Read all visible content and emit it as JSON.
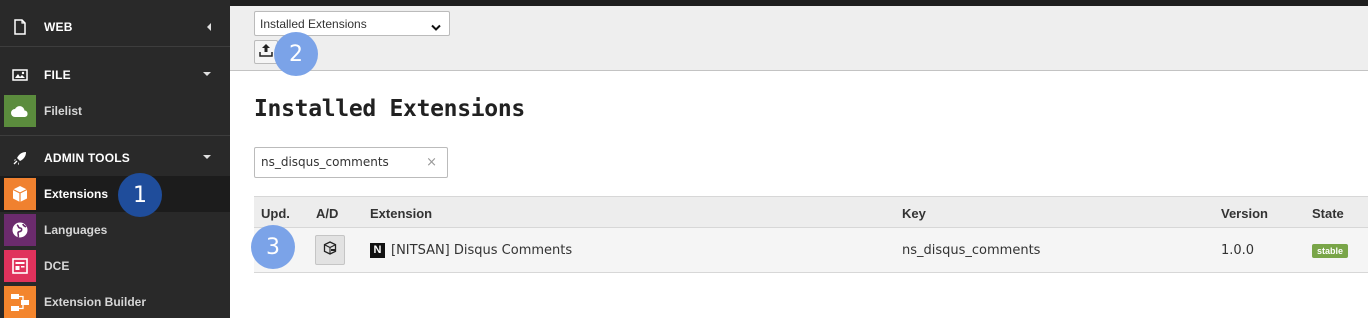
{
  "sidebar": {
    "groups": [
      {
        "label": "WEB",
        "icon": "document-icon"
      },
      {
        "label": "FILE",
        "icon": "image-icon"
      },
      {
        "label": "ADMIN TOOLS",
        "icon": "rocket-icon"
      }
    ],
    "items": [
      {
        "label": "Filelist",
        "icon": "cloud-icon",
        "color": "#5b8c3d"
      },
      {
        "label": "Extensions",
        "icon": "box-icon",
        "color": "#f0812f"
      },
      {
        "label": "Languages",
        "icon": "globe-icon",
        "color": "#6b2b6d"
      },
      {
        "label": "DCE",
        "icon": "dce-icon",
        "color": "#e0325c"
      },
      {
        "label": "Extension Builder",
        "icon": "builder-icon",
        "color": "#f3852d"
      }
    ]
  },
  "docheader": {
    "menu_select": {
      "value": "Installed Extensions",
      "options": [
        "Installed Extensions"
      ]
    },
    "upload_icon": "upload-icon"
  },
  "main": {
    "title": "Installed Extensions",
    "search": {
      "value": "ns_disqus_comments",
      "clear_glyph": "×"
    },
    "table": {
      "headers": [
        "Upd.",
        "A/D",
        "Extension",
        "Key",
        "Version",
        "State"
      ],
      "rows": [
        {
          "upd": "",
          "ad_icon": "deactivate-icon",
          "logo": "N",
          "extension": "[NITSAN] Disqus Comments",
          "key": "ns_disqus_comments",
          "version": "1.0.0",
          "state": "stable"
        }
      ]
    }
  },
  "callouts": [
    {
      "number": "1",
      "color": "#1f4d9b"
    },
    {
      "number": "2",
      "color": "#7ba3e8"
    },
    {
      "number": "3",
      "color": "#7ba3e8"
    }
  ],
  "colors": {
    "sidebar_bg": "#292929",
    "docheader_bg": "#eeeeee",
    "state_stable": "#79a548"
  }
}
